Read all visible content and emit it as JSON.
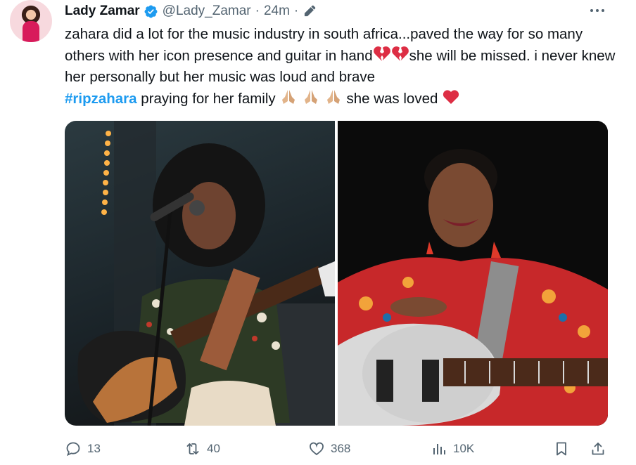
{
  "author": {
    "name": "Lady Zamar",
    "handle": "@Lady_Zamar",
    "separator": "·",
    "time": "24m",
    "time_separator": "·"
  },
  "tweet": {
    "text_part1": "zahara did a lot for the music industry in south africa...paved the way for so many others with her icon presence and guitar in hand",
    "text_part2": "she will be missed. i never knew her personally but her music was loud and brave",
    "hashtag": "#ripzahara",
    "text_part3": " praying for her family ",
    "text_part4": " she was loved "
  },
  "icons": {
    "verified": "verified-badge-icon",
    "edit": "edit-pencil-icon",
    "more": "more-options-icon",
    "broken_heart": "broken-heart-emoji",
    "praying_hands": "folded-hands-emoji",
    "red_heart": "red-heart-emoji"
  },
  "media": {
    "photos": [
      "photo-performing-with-guitar",
      "photo-smiling-with-guitar"
    ]
  },
  "actions": {
    "replies": "13",
    "reposts": "40",
    "likes": "368",
    "views": "10K"
  },
  "colors": {
    "accent": "#1d9bf0",
    "secondary_text": "#536471",
    "heart_red": "#e0245e"
  }
}
